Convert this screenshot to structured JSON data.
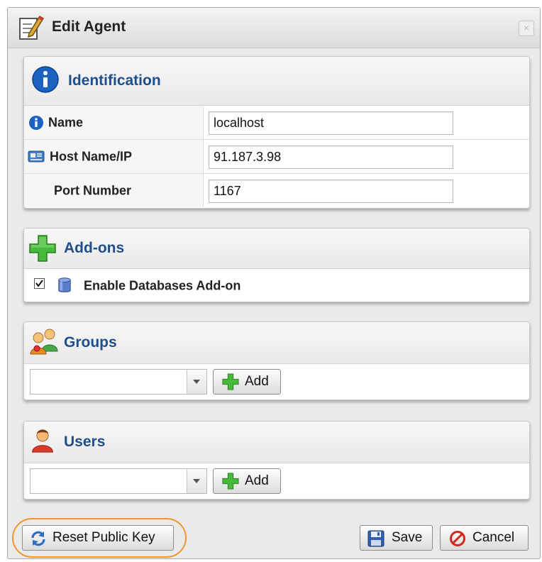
{
  "dialog": {
    "title": "Edit Agent",
    "close_symbol": "×",
    "title_icon": "edit-document-icon",
    "close_icon": "close-icon"
  },
  "identification": {
    "title": "Identification",
    "header_icon": "info-icon",
    "rows": [
      {
        "label": "Name",
        "icon": "info-small-icon",
        "value": "localhost"
      },
      {
        "label": "Host Name/IP",
        "icon": "host-icon",
        "value": "91.187.3.98"
      },
      {
        "label": "Port Number",
        "icon": "",
        "value": "1167"
      }
    ]
  },
  "addons": {
    "title": "Add-ons",
    "header_icon": "plus-icon",
    "items": [
      {
        "label": "Enable Databases Add-on",
        "checked": true,
        "icon": "database-icon"
      }
    ]
  },
  "groups": {
    "title": "Groups",
    "header_icon": "groups-icon",
    "select_value": "",
    "add_label": "Add",
    "add_icon": "plus-icon"
  },
  "users": {
    "title": "Users",
    "header_icon": "user-icon",
    "select_value": "",
    "add_label": "Add",
    "add_icon": "plus-icon"
  },
  "footer": {
    "reset_label": "Reset Public Key",
    "reset_icon": "refresh-icon",
    "save_label": "Save",
    "save_icon": "floppy-disk-icon",
    "cancel_label": "Cancel",
    "cancel_icon": "cancel-icon"
  },
  "colors": {
    "panel_title": "#1e4f8c",
    "highlight_ring": "#f0962a",
    "dialog_bg": "#eaeaea"
  }
}
